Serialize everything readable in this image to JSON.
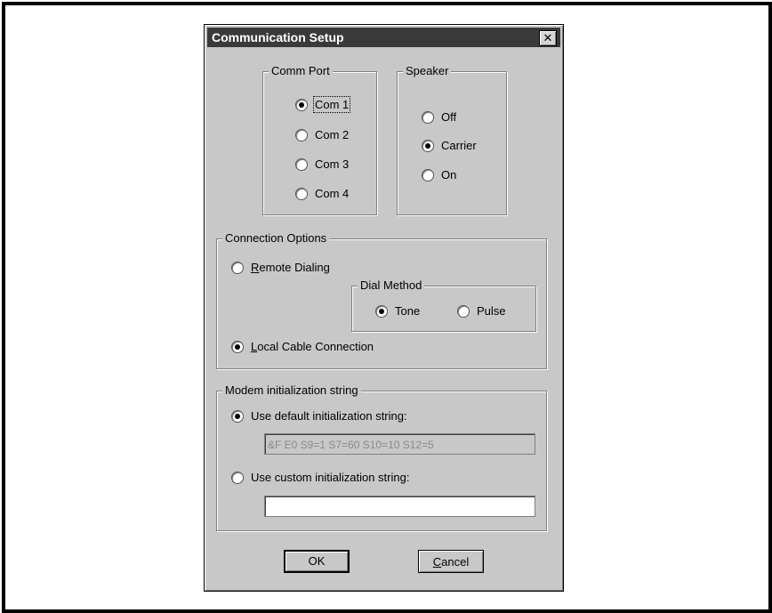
{
  "dialog": {
    "title": "Communication Setup",
    "close_label": "✕"
  },
  "comm_port": {
    "label": "Comm Port",
    "options": [
      "Com 1",
      "Com 2",
      "Com 3",
      "Com 4"
    ],
    "selected": "Com 1"
  },
  "speaker": {
    "label": "Speaker",
    "options": [
      "Off",
      "Carrier",
      "On"
    ],
    "selected": "Carrier"
  },
  "connection_options": {
    "label": "Connection Options",
    "remote_dialing": {
      "mnemonic": "R",
      "rest": "emote Dialing"
    },
    "local_cable": {
      "mnemonic": "L",
      "rest": "ocal Cable Connection"
    },
    "selected": "Local Cable Connection",
    "dial_method": {
      "label": "Dial Method",
      "options": [
        "Tone",
        "Pulse"
      ],
      "selected": "Tone"
    }
  },
  "modem_init": {
    "label": "Modem initialization string",
    "use_default_label": "Use default initialization string:",
    "default_value": "&F E0 S9=1 S7=60 S10=10 S12=5",
    "use_custom_label": "Use custom initialization string:",
    "custom_value": "",
    "selected": "default"
  },
  "buttons": {
    "ok_label": "OK",
    "cancel": {
      "mnemonic": "C",
      "rest": "ancel"
    }
  }
}
